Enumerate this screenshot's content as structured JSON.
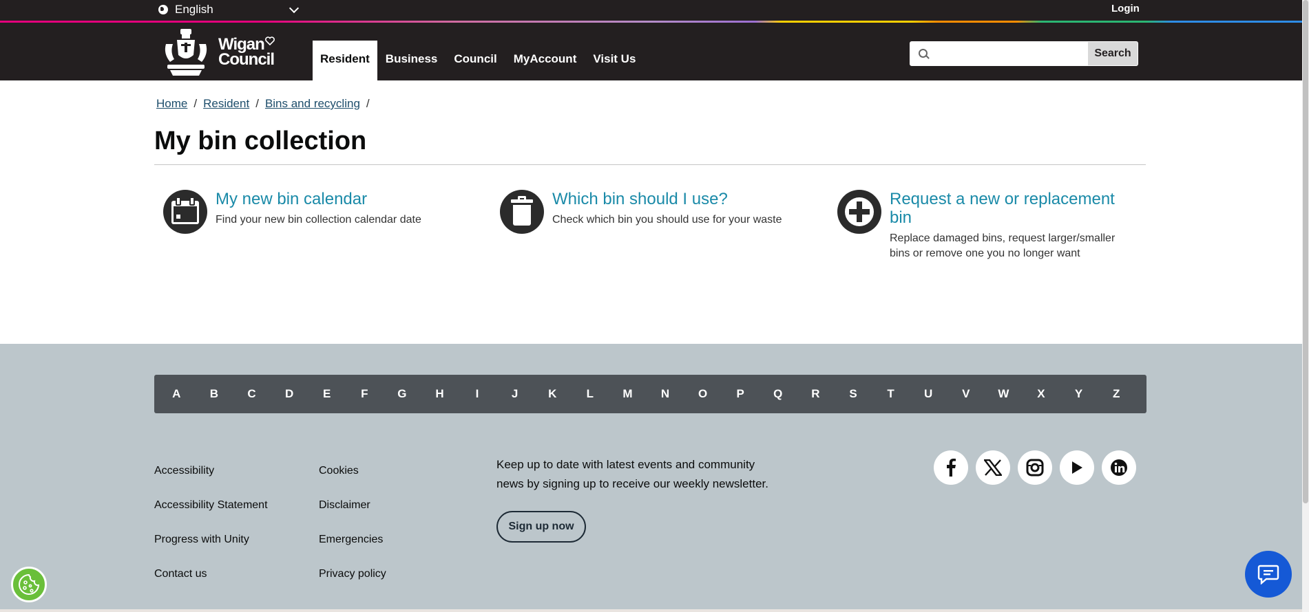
{
  "topbar": {
    "language": "English",
    "login": "Login"
  },
  "logo": {
    "line1": "Wigan",
    "line2": "Council"
  },
  "nav": {
    "items": [
      "Resident",
      "Business",
      "Council",
      "MyAccount",
      "Visit Us"
    ]
  },
  "search": {
    "placeholder": "",
    "button": "Search"
  },
  "breadcrumb": {
    "items": [
      "Home",
      "Resident",
      "Bins and recycling"
    ],
    "separator": "/"
  },
  "page": {
    "title": "My bin collection"
  },
  "cards": [
    {
      "title": "My new bin calendar",
      "desc": "Find your new bin collection calendar date",
      "icon": "calendar-icon"
    },
    {
      "title": "Which bin should I use?",
      "desc": "Check which bin you should use for your waste",
      "icon": "bin-icon"
    },
    {
      "title_line1": "Request a new or replacement",
      "title_line2": "bin",
      "desc_line1": "Replace damaged bins, request larger/smaller",
      "desc_line2": "bins or remove one you no longer want",
      "icon": "plus-circle-icon"
    }
  ],
  "az": [
    "A",
    "B",
    "C",
    "D",
    "E",
    "F",
    "G",
    "H",
    "I",
    "J",
    "K",
    "L",
    "M",
    "N",
    "O",
    "P",
    "Q",
    "R",
    "S",
    "T",
    "U",
    "V",
    "W",
    "X",
    "Y",
    "Z"
  ],
  "footer": {
    "col1": [
      "Accessibility",
      "Accessibility Statement",
      "Progress with Unity",
      "Contact us"
    ],
    "col2": [
      "Cookies",
      "Disclaimer",
      "Emergencies",
      "Privacy policy"
    ],
    "newsletter_line1": "Keep up to date with latest events and community",
    "newsletter_line2": "news by signing up to receive our weekly newsletter.",
    "signup": "Sign up now",
    "social": [
      "facebook-icon",
      "x-icon",
      "instagram-icon",
      "youtube-icon",
      "linkedin-icon"
    ]
  },
  "colors": {
    "header_bg": "#231f20",
    "link_teal": "#1a8aa8",
    "footer_bg": "#bcc6cb",
    "az_bg": "#4d5257",
    "chat_blue": "#1559d6",
    "cookie_green": "#6abf3a"
  }
}
